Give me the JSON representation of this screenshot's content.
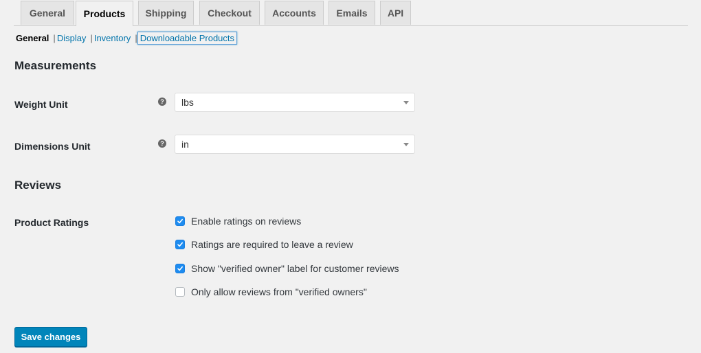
{
  "tabs": [
    {
      "label": "General",
      "active": false
    },
    {
      "label": "Products",
      "active": true
    },
    {
      "label": "Shipping",
      "active": false
    },
    {
      "label": "Checkout",
      "active": false
    },
    {
      "label": "Accounts",
      "active": false
    },
    {
      "label": "Emails",
      "active": false
    },
    {
      "label": "API",
      "active": false
    }
  ],
  "subnav": {
    "current": "General",
    "separator": "|",
    "links": [
      "Display",
      "Inventory",
      "Downloadable Products"
    ]
  },
  "measurements": {
    "heading": "Measurements",
    "weight": {
      "label": "Weight Unit",
      "help": "?",
      "value": "lbs"
    },
    "dimensions": {
      "label": "Dimensions Unit",
      "help": "?",
      "value": "in"
    }
  },
  "reviews": {
    "heading": "Reviews",
    "ratings_label": "Product Ratings",
    "options": [
      {
        "label": "Enable ratings on reviews",
        "checked": true
      },
      {
        "label": "Ratings are required to leave a review",
        "checked": true
      },
      {
        "label": "Show \"verified owner\" label for customer reviews",
        "checked": true
      },
      {
        "label": "Only allow reviews from \"verified owners\"",
        "checked": false
      }
    ]
  },
  "save_label": "Save changes"
}
